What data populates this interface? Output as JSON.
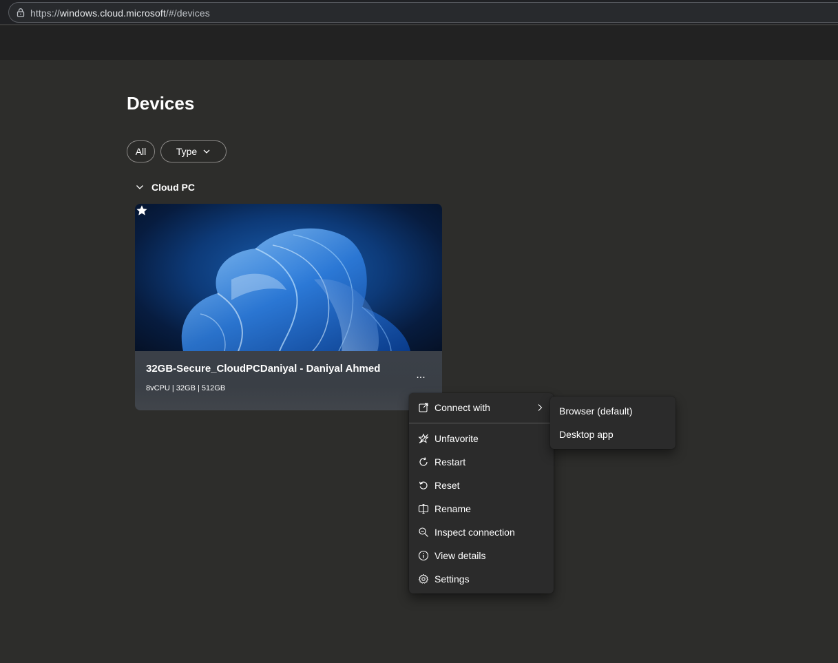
{
  "browser": {
    "url_prefix": "https://",
    "url_host": "windows.cloud.microsoft",
    "url_path": "/#/devices"
  },
  "page": {
    "title": "Devices"
  },
  "filters": {
    "all_label": "All",
    "type_label": "Type"
  },
  "section": {
    "label": "Cloud PC"
  },
  "device_card": {
    "name": "32GB-Secure_CloudPCDaniyal - Daniyal Ahmed",
    "specs": "8vCPU | 32GB | 512GB",
    "more_label": "...",
    "favorited": true
  },
  "context_menu": {
    "connect_with": "Connect with",
    "items": [
      {
        "label": "Unfavorite",
        "icon": "star-off-icon"
      },
      {
        "label": "Restart",
        "icon": "restart-icon"
      },
      {
        "label": "Reset",
        "icon": "reset-icon"
      },
      {
        "label": "Rename",
        "icon": "rename-icon"
      },
      {
        "label": "Inspect connection",
        "icon": "inspect-icon"
      },
      {
        "label": "View details",
        "icon": "info-icon"
      },
      {
        "label": "Settings",
        "icon": "gear-icon"
      }
    ]
  },
  "submenu": {
    "items": [
      {
        "label": "Browser (default)"
      },
      {
        "label": "Desktop app"
      }
    ]
  },
  "colors": {
    "page_bg": "#2d2d2b",
    "menu_bg": "#2b2b2b",
    "card_accent": "#1a5fb0"
  }
}
